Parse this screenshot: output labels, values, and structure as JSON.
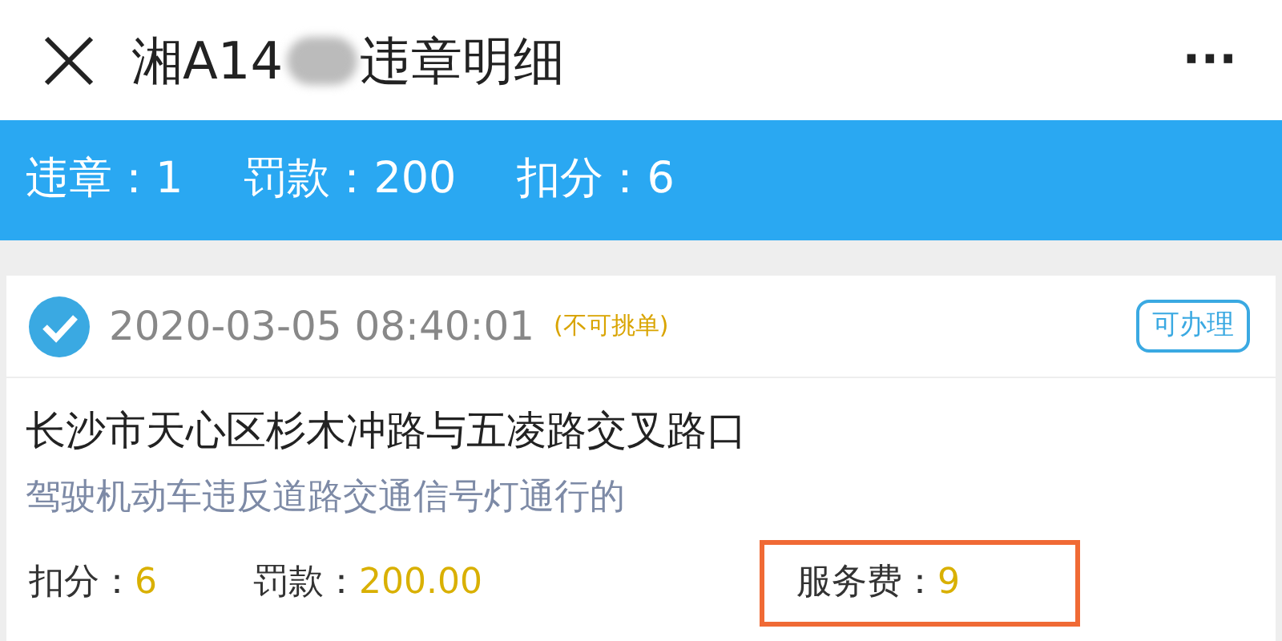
{
  "header": {
    "title_start": "湘A14",
    "title_end": "违章明细",
    "more": "···"
  },
  "summary": [
    {
      "label": "违章：",
      "value": "1"
    },
    {
      "label": "罚款：",
      "value": "200"
    },
    {
      "label": "扣分：",
      "value": "6"
    }
  ],
  "record": {
    "checked": true,
    "time": "2020-03-05 08:40:01",
    "note": "(不可挑单)",
    "status": "可办理",
    "location": "长沙市天心区杉木冲路与五凌路交叉路口",
    "violation": "驾驶机动车违反道路交通信号灯通行的",
    "details": [
      {
        "label": "扣分：",
        "value": "6",
        "highlighted": false
      },
      {
        "label": "罚款：",
        "value": "200.00",
        "highlighted": false
      },
      {
        "label": "服务费：",
        "value": "9",
        "highlighted": true
      }
    ]
  }
}
